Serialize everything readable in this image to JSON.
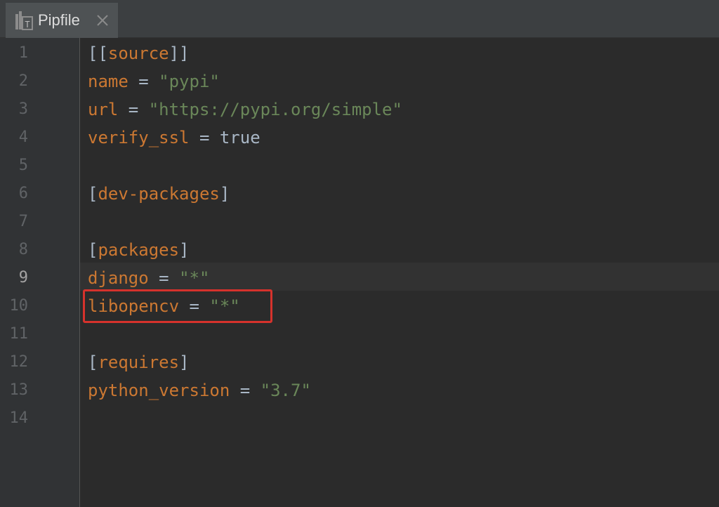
{
  "tab": {
    "title": "Pipfile",
    "icon": "pipfile-icon",
    "close_icon": "close-icon"
  },
  "editor": {
    "current_line": "9",
    "line_numbers": [
      "1",
      "2",
      "3",
      "4",
      "5",
      "6",
      "7",
      "8",
      "9",
      "10",
      "11",
      "12",
      "13",
      "14"
    ],
    "lines": [
      {
        "type": "section",
        "open": "[[",
        "name": "source",
        "close": "]]"
      },
      {
        "type": "kv",
        "key": "name",
        "op": " = ",
        "value": "\"pypi\""
      },
      {
        "type": "kv",
        "key": "url",
        "op": " = ",
        "value": "\"https://pypi.org/simple\""
      },
      {
        "type": "kvbool",
        "key": "verify_ssl",
        "op": " = ",
        "value": "true"
      },
      {
        "type": "empty"
      },
      {
        "type": "section",
        "open": "[",
        "name": "dev-packages",
        "close": "]"
      },
      {
        "type": "empty"
      },
      {
        "type": "section",
        "open": "[",
        "name": "packages",
        "close": "]"
      },
      {
        "type": "kv",
        "key": "django",
        "op": " = ",
        "value": "\"*\""
      },
      {
        "type": "kv",
        "key": "libopencv",
        "op": " = ",
        "value": "\"*\""
      },
      {
        "type": "empty"
      },
      {
        "type": "section",
        "open": "[",
        "name": "requires",
        "close": "]"
      },
      {
        "type": "kv",
        "key": "python_version",
        "op": " = ",
        "value": "\"3.7\""
      },
      {
        "type": "empty"
      }
    ]
  },
  "colors": {
    "key": "#cc7832",
    "string": "#6a8759",
    "plain": "#a9b7c6",
    "highlight_border": "#d6322c",
    "background": "#2b2b2b",
    "gutter": "#313335"
  }
}
